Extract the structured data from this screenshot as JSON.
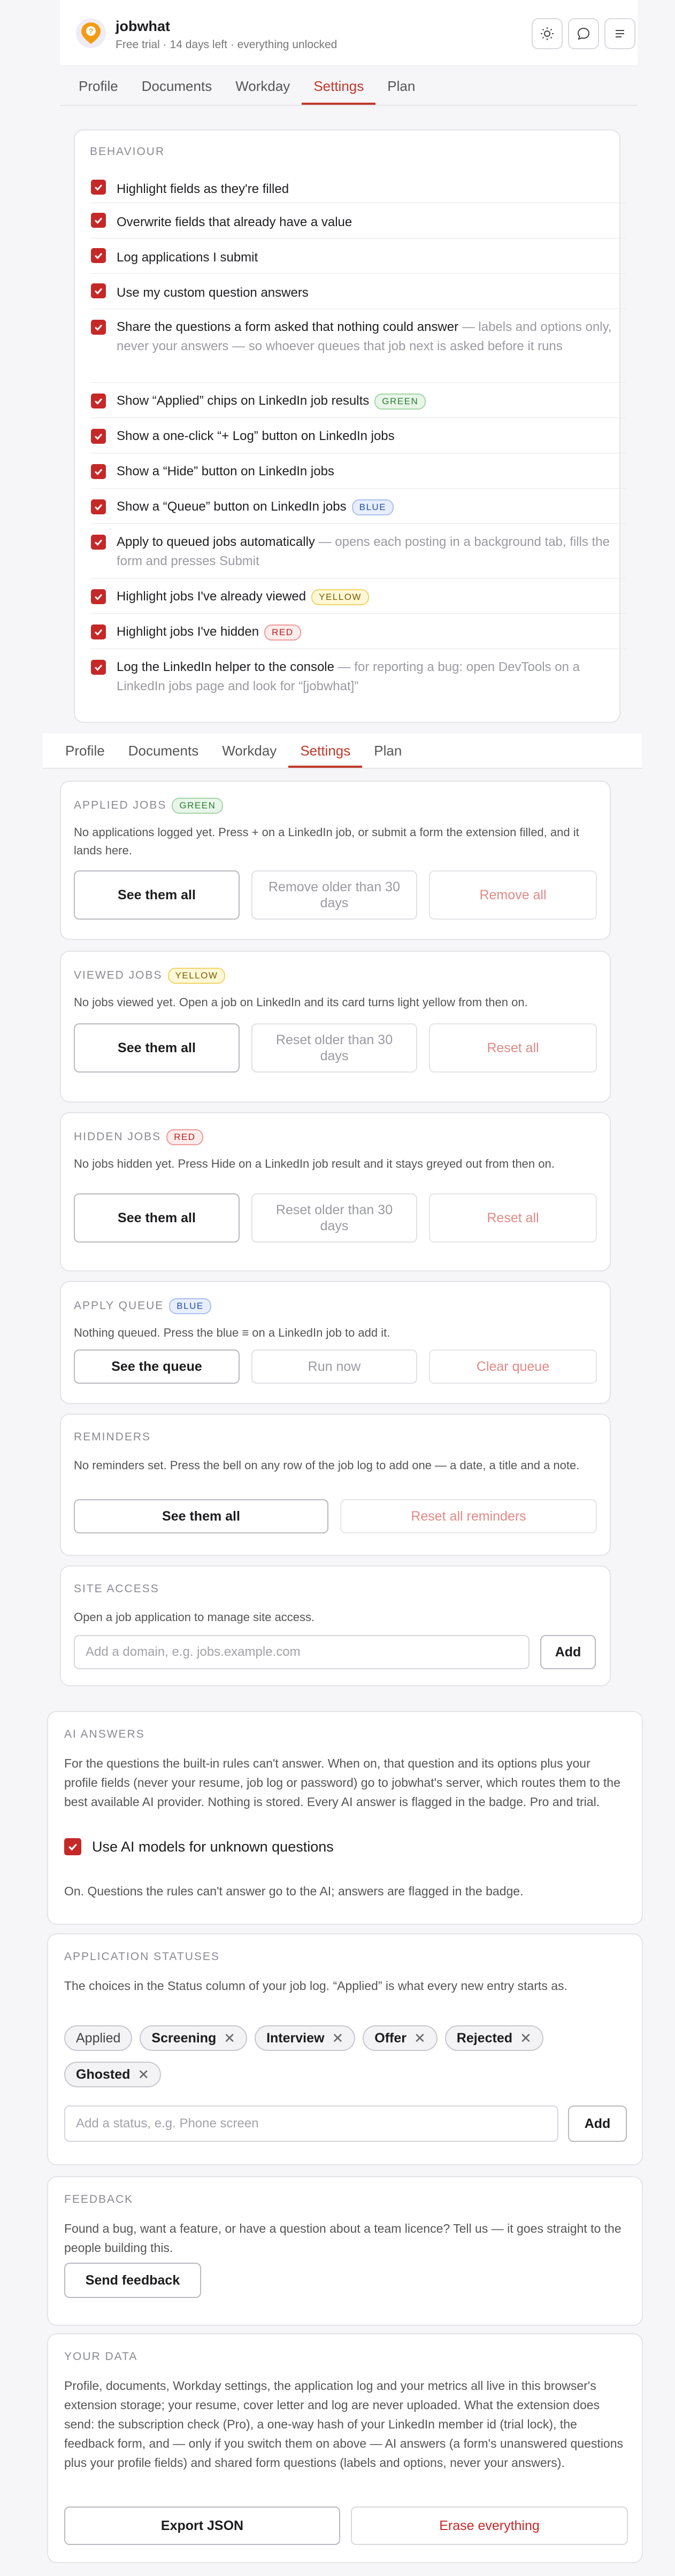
{
  "header": {
    "title": "jobwhat",
    "subtitle": "Free trial · 14 days left · everything unlocked",
    "icons": [
      "sun-icon",
      "chat-icon",
      "menu-icon"
    ]
  },
  "tabs_top": [
    {
      "label": "Profile",
      "active": false
    },
    {
      "label": "Documents",
      "active": false
    },
    {
      "label": "Workday",
      "active": false
    },
    {
      "label": "Settings",
      "active": true
    },
    {
      "label": "Plan",
      "active": false
    }
  ],
  "behaviour": {
    "label": "BEHAVIOUR",
    "items": [
      {
        "text": "Highlight fields as they're filled",
        "checked": true
      },
      {
        "text": "Overwrite fields that already have a value",
        "checked": true
      },
      {
        "text": "Log applications I submit",
        "checked": true
      },
      {
        "text": "Use my custom question answers",
        "checked": true
      },
      {
        "text": "Share the questions a form asked that nothing could answer",
        "muted": " — labels and options only, never your answers — so whoever queues that job next is asked before it runs",
        "checked": true
      },
      {
        "text": "Show “Applied” chips on LinkedIn job results",
        "pill": "GREEN",
        "checked": true
      },
      {
        "text": "Show a one-click “+ Log” button on LinkedIn jobs",
        "checked": true
      },
      {
        "text": "Show a “Hide” button on LinkedIn jobs",
        "checked": true
      },
      {
        "text": "Show a “Queue” button on LinkedIn jobs",
        "pill": "BLUE",
        "checked": true
      },
      {
        "text": "Apply to queued jobs automatically",
        "muted": " — opens each posting in a background tab, fills the form and presses Submit",
        "checked": true
      },
      {
        "text": "Highlight jobs I've already viewed",
        "pill": "YELLOW",
        "checked": true
      },
      {
        "text": "Highlight jobs I've hidden",
        "pill": "RED",
        "checked": true
      },
      {
        "text": "Log the LinkedIn helper to the console",
        "muted": " — for reporting a bug: open DevTools on a LinkedIn jobs page and look for “[jobwhat]”",
        "checked": true
      }
    ]
  },
  "tabs_second": [
    {
      "label": "Profile",
      "active": false
    },
    {
      "label": "Documents",
      "active": false
    },
    {
      "label": "Workday",
      "active": false
    },
    {
      "label": "Settings",
      "active": true
    },
    {
      "label": "Plan",
      "active": false
    }
  ],
  "applied": {
    "label": "APPLIED JOBS",
    "pill": "GREEN",
    "desc": "No applications logged yet. Press + on a LinkedIn job, or submit a form the extension filled, and it lands here.",
    "btn1": "See them all",
    "btn2": "Remove older than 30 days",
    "btn3": "Remove all"
  },
  "viewed": {
    "label": "VIEWED JOBS",
    "pill": "YELLOW",
    "desc": "No jobs viewed yet. Open a job on LinkedIn and its card turns light yellow from then on.",
    "btn1": "See them all",
    "btn2": "Reset older than 30 days",
    "btn3": "Reset all"
  },
  "hidden": {
    "label": "HIDDEN JOBS",
    "pill": "RED",
    "desc": "No jobs hidden yet. Press Hide on a LinkedIn job result and it stays greyed out from then on.",
    "btn1": "See them all",
    "btn2": "Reset older than 30 days",
    "btn3": "Reset all"
  },
  "queue": {
    "label": "APPLY QUEUE",
    "pill": "BLUE",
    "desc": "Nothing queued. Press the blue ≡ on a LinkedIn job to add it.",
    "btn1": "See the queue",
    "btn2": "Run now",
    "btn3": "Clear queue"
  },
  "reminders": {
    "label": "REMINDERS",
    "desc": "No reminders set. Press the bell on any row of the job log to add one — a date, a title and a note.",
    "btn1": "See them all",
    "btn2": "Reset all reminders"
  },
  "site_access": {
    "label": "SITE ACCESS",
    "desc": "Open a job application to manage site access.",
    "placeholder": "Add a domain, e.g. jobs.example.com",
    "add": "Add"
  },
  "ai": {
    "label": "AI ANSWERS",
    "desc": "For the questions the built-in rules can't answer. When on, that question and its options plus your profile fields (never your resume, job log or password) go to jobwhat's server, which routes them to the best available AI provider. Nothing is stored. Every AI answer is flagged in the badge. Pro and trial.",
    "toggle": "Use AI models for unknown questions",
    "checked": true,
    "status": "On. Questions the rules can't answer go to the AI; answers are flagged in the badge."
  },
  "statuses": {
    "label": "APPLICATION STATUSES",
    "desc": "The choices in the Status column of your job log. “Applied” is what every new entry starts as.",
    "chips": [
      {
        "label": "Applied",
        "removable": false
      },
      {
        "label": "Screening",
        "removable": true
      },
      {
        "label": "Interview",
        "removable": true
      },
      {
        "label": "Offer",
        "removable": true
      },
      {
        "label": "Rejected",
        "removable": true
      },
      {
        "label": "Ghosted",
        "removable": true
      }
    ],
    "placeholder": "Add a status, e.g. Phone screen",
    "add": "Add"
  },
  "feedback": {
    "label": "FEEDBACK",
    "desc": "Found a bug, want a feature, or have a question about a team licence? Tell us — it goes straight to the people building this.",
    "btn": "Send feedback"
  },
  "your_data": {
    "label": "YOUR DATA",
    "desc": "Profile, documents, Workday settings, the application log and your metrics all live in this browser's extension storage; your resume, cover letter and log are never uploaded. What the extension does send: the subscription check (Pro), a one-way hash of your LinkedIn member id (trial lock), the feedback form, and — only if you switch them on above — AI answers (a form's unanswered questions plus your profile fields) and shared form questions (labels and options, never your answers).",
    "export": "Export JSON",
    "erase": "Erase everything"
  },
  "colors": {
    "accent": "#c62828",
    "tab_active": "#c0392b"
  }
}
